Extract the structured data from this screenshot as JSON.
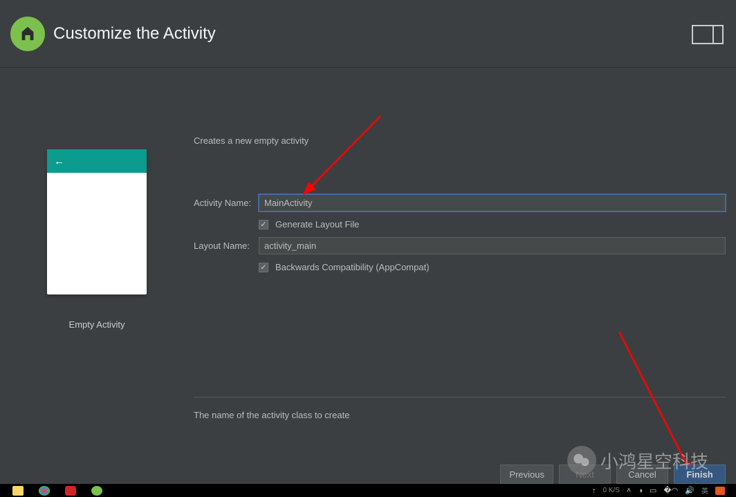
{
  "header": {
    "title": "Customize the Activity"
  },
  "preview": {
    "label": "Empty Activity"
  },
  "form": {
    "description": "Creates a new empty activity",
    "activity_name_label": "Activity Name:",
    "activity_name_value": "MainActivity",
    "generate_layout_label": "Generate Layout File",
    "layout_name_label": "Layout Name:",
    "layout_name_value": "activity_main",
    "backwards_compat_label": "Backwards Compatibility (AppCompat)",
    "help_text": "The name of the activity class to create"
  },
  "buttons": {
    "previous": "Previous",
    "next": "Next",
    "cancel": "Cancel",
    "finish": "Finish"
  },
  "watermark": {
    "text": "小鸿星空科技"
  },
  "taskbar": {
    "net_speed": "0 K/S",
    "ime": "英"
  }
}
